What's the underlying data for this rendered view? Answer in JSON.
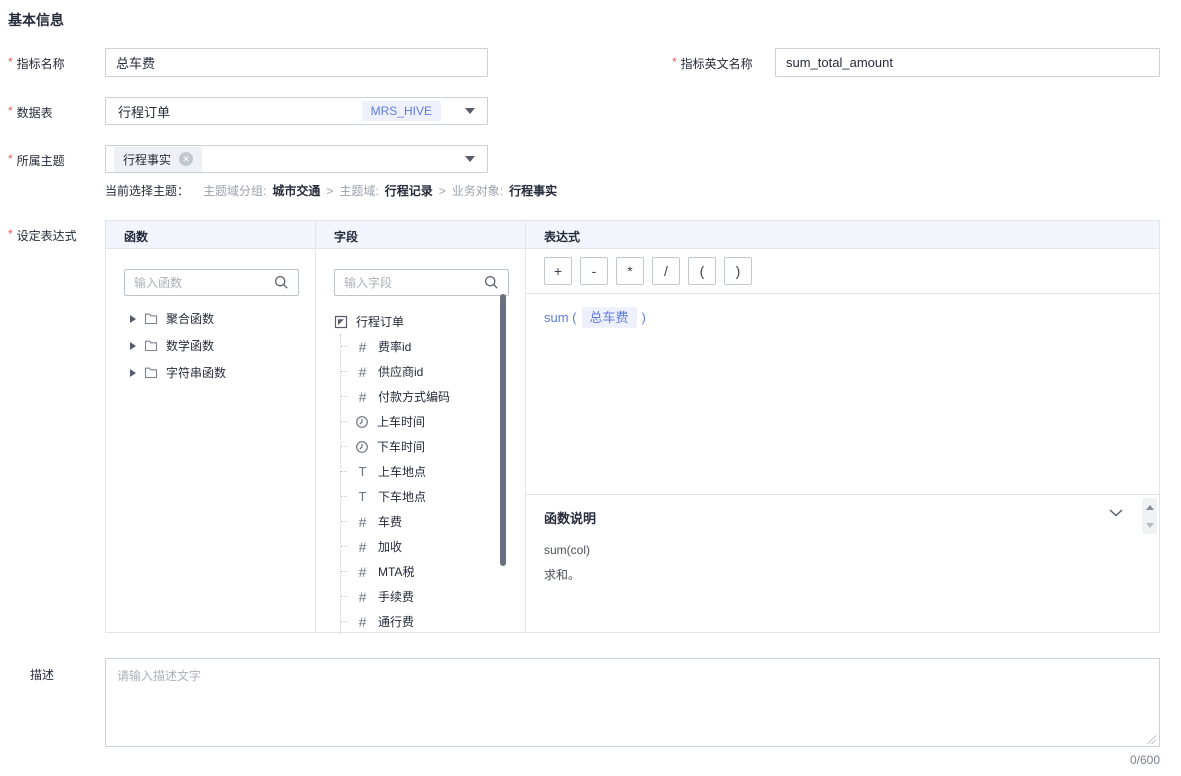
{
  "header": {
    "title": "基本信息"
  },
  "form": {
    "metric_name": {
      "label": "指标名称",
      "value": "总车费"
    },
    "metric_en_name": {
      "label": "指标英文名称",
      "value": "sum_total_amount"
    },
    "data_table": {
      "label": "数据表",
      "value": "行程订单",
      "type_tag": "MRS_HIVE"
    },
    "subject": {
      "label": "所属主题",
      "selected_tag": "行程事实"
    },
    "current_subject": {
      "label": "当前选择主题：",
      "group_key": "主题域分组:",
      "group_value": "城市交通",
      "domain_key": "主题域:",
      "domain_value": "行程记录",
      "object_key": "业务对象:",
      "object_value": "行程事实",
      "separator": ">"
    },
    "expression_label": "设定表达式",
    "description": {
      "label": "描述",
      "placeholder": "请输入描述文字",
      "counter": "0/600"
    }
  },
  "functions_panel": {
    "title": "函数",
    "search_placeholder": "输入函数",
    "groups": [
      {
        "label": "聚合函数"
      },
      {
        "label": "数学函数"
      },
      {
        "label": "字符串函数"
      }
    ]
  },
  "fields_panel": {
    "title": "字段",
    "search_placeholder": "输入字段",
    "root_label": "行程订单",
    "fields": [
      {
        "type": "number",
        "label": "费率id"
      },
      {
        "type": "number",
        "label": "供应商id"
      },
      {
        "type": "number",
        "label": "付款方式编码"
      },
      {
        "type": "time",
        "label": "上车时间"
      },
      {
        "type": "time",
        "label": "下车时间"
      },
      {
        "type": "text",
        "label": "上车地点"
      },
      {
        "type": "text",
        "label": "下车地点"
      },
      {
        "type": "number",
        "label": "车费"
      },
      {
        "type": "number",
        "label": "加收"
      },
      {
        "type": "number",
        "label": "MTA税"
      },
      {
        "type": "number",
        "label": "手续费"
      },
      {
        "type": "number",
        "label": "通行费"
      }
    ]
  },
  "expression_panel": {
    "title": "表达式",
    "operators": [
      "+",
      "-",
      "*",
      "/",
      "(",
      ")"
    ],
    "expression": {
      "function_open": "sum (",
      "field_chip": "总车费",
      "close": ")"
    },
    "doc": {
      "title": "函数说明",
      "signature": "sum(col)",
      "description": "求和。"
    }
  },
  "icons": {
    "number_glyph": "#",
    "text_glyph": "T"
  },
  "colors": {
    "accent_blue": "#5e7ce0",
    "required_red": "#f45a5a",
    "chip_bg": "#eef1fb",
    "gray_tag_bg": "#eef0f5",
    "panel_header_bg": "#f2f5fc",
    "border": "#e1e5eb",
    "scrollbar": "#667080"
  }
}
